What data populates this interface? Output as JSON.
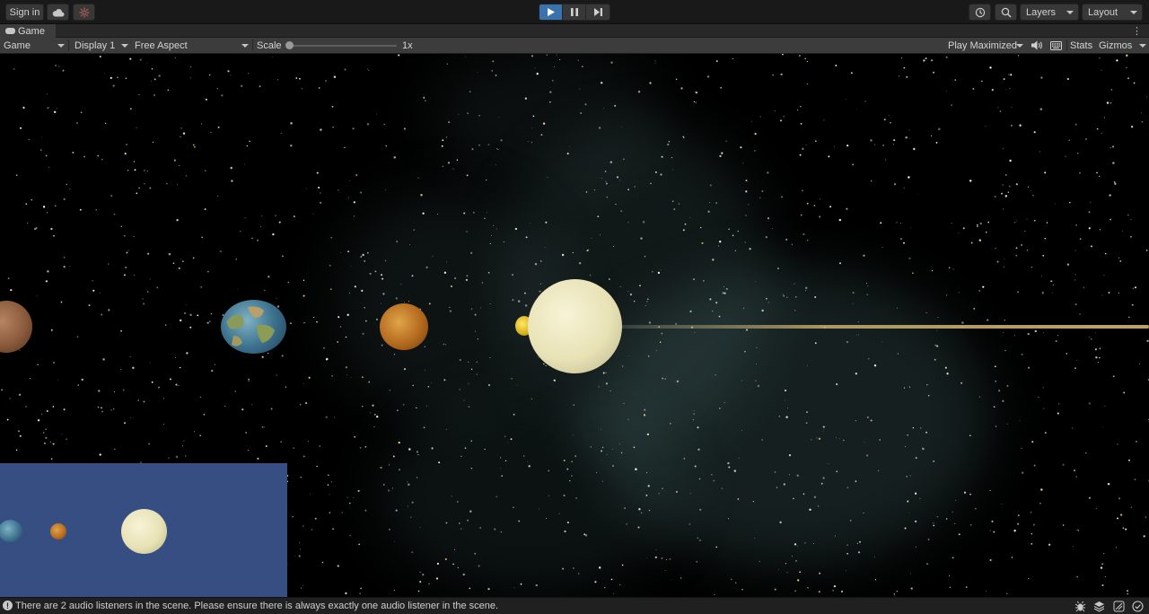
{
  "toolbar": {
    "sign_in_label": "Sign in",
    "cloud_icon": "cloud-icon",
    "collab_icon": "collab-icon",
    "play_controls": [
      "play-icon",
      "pause-icon",
      "step-icon"
    ],
    "play_active": true,
    "layers_label": "Layers",
    "layout_label": "Layout"
  },
  "tab": {
    "label": "Game",
    "icon": "gamepad-icon"
  },
  "game_toolbar": {
    "view_label": "Game",
    "display_label": "Display 1",
    "aspect_label": "Free Aspect",
    "scale_label": "Scale",
    "scale_value": "1x",
    "scale_fraction": 0.0,
    "play_mode_label": "Play Maximized",
    "stats_label": "Stats",
    "gizmos_label": "Gizmos"
  },
  "scene": {
    "background": "starfield-nebula",
    "planets": [
      "mars-like",
      "earth",
      "venus-like",
      "mercury",
      "sun"
    ],
    "minimap_planets": [
      "earth",
      "venus-like",
      "sun"
    ],
    "accent_colors": {
      "play_active": "#3a72b0",
      "minimap_bg": "#364e82",
      "sun": "#eeeac8"
    }
  },
  "status": {
    "message": "There are 2 audio listeners in the scene. Please ensure there is always exactly one audio listener in the scene."
  }
}
